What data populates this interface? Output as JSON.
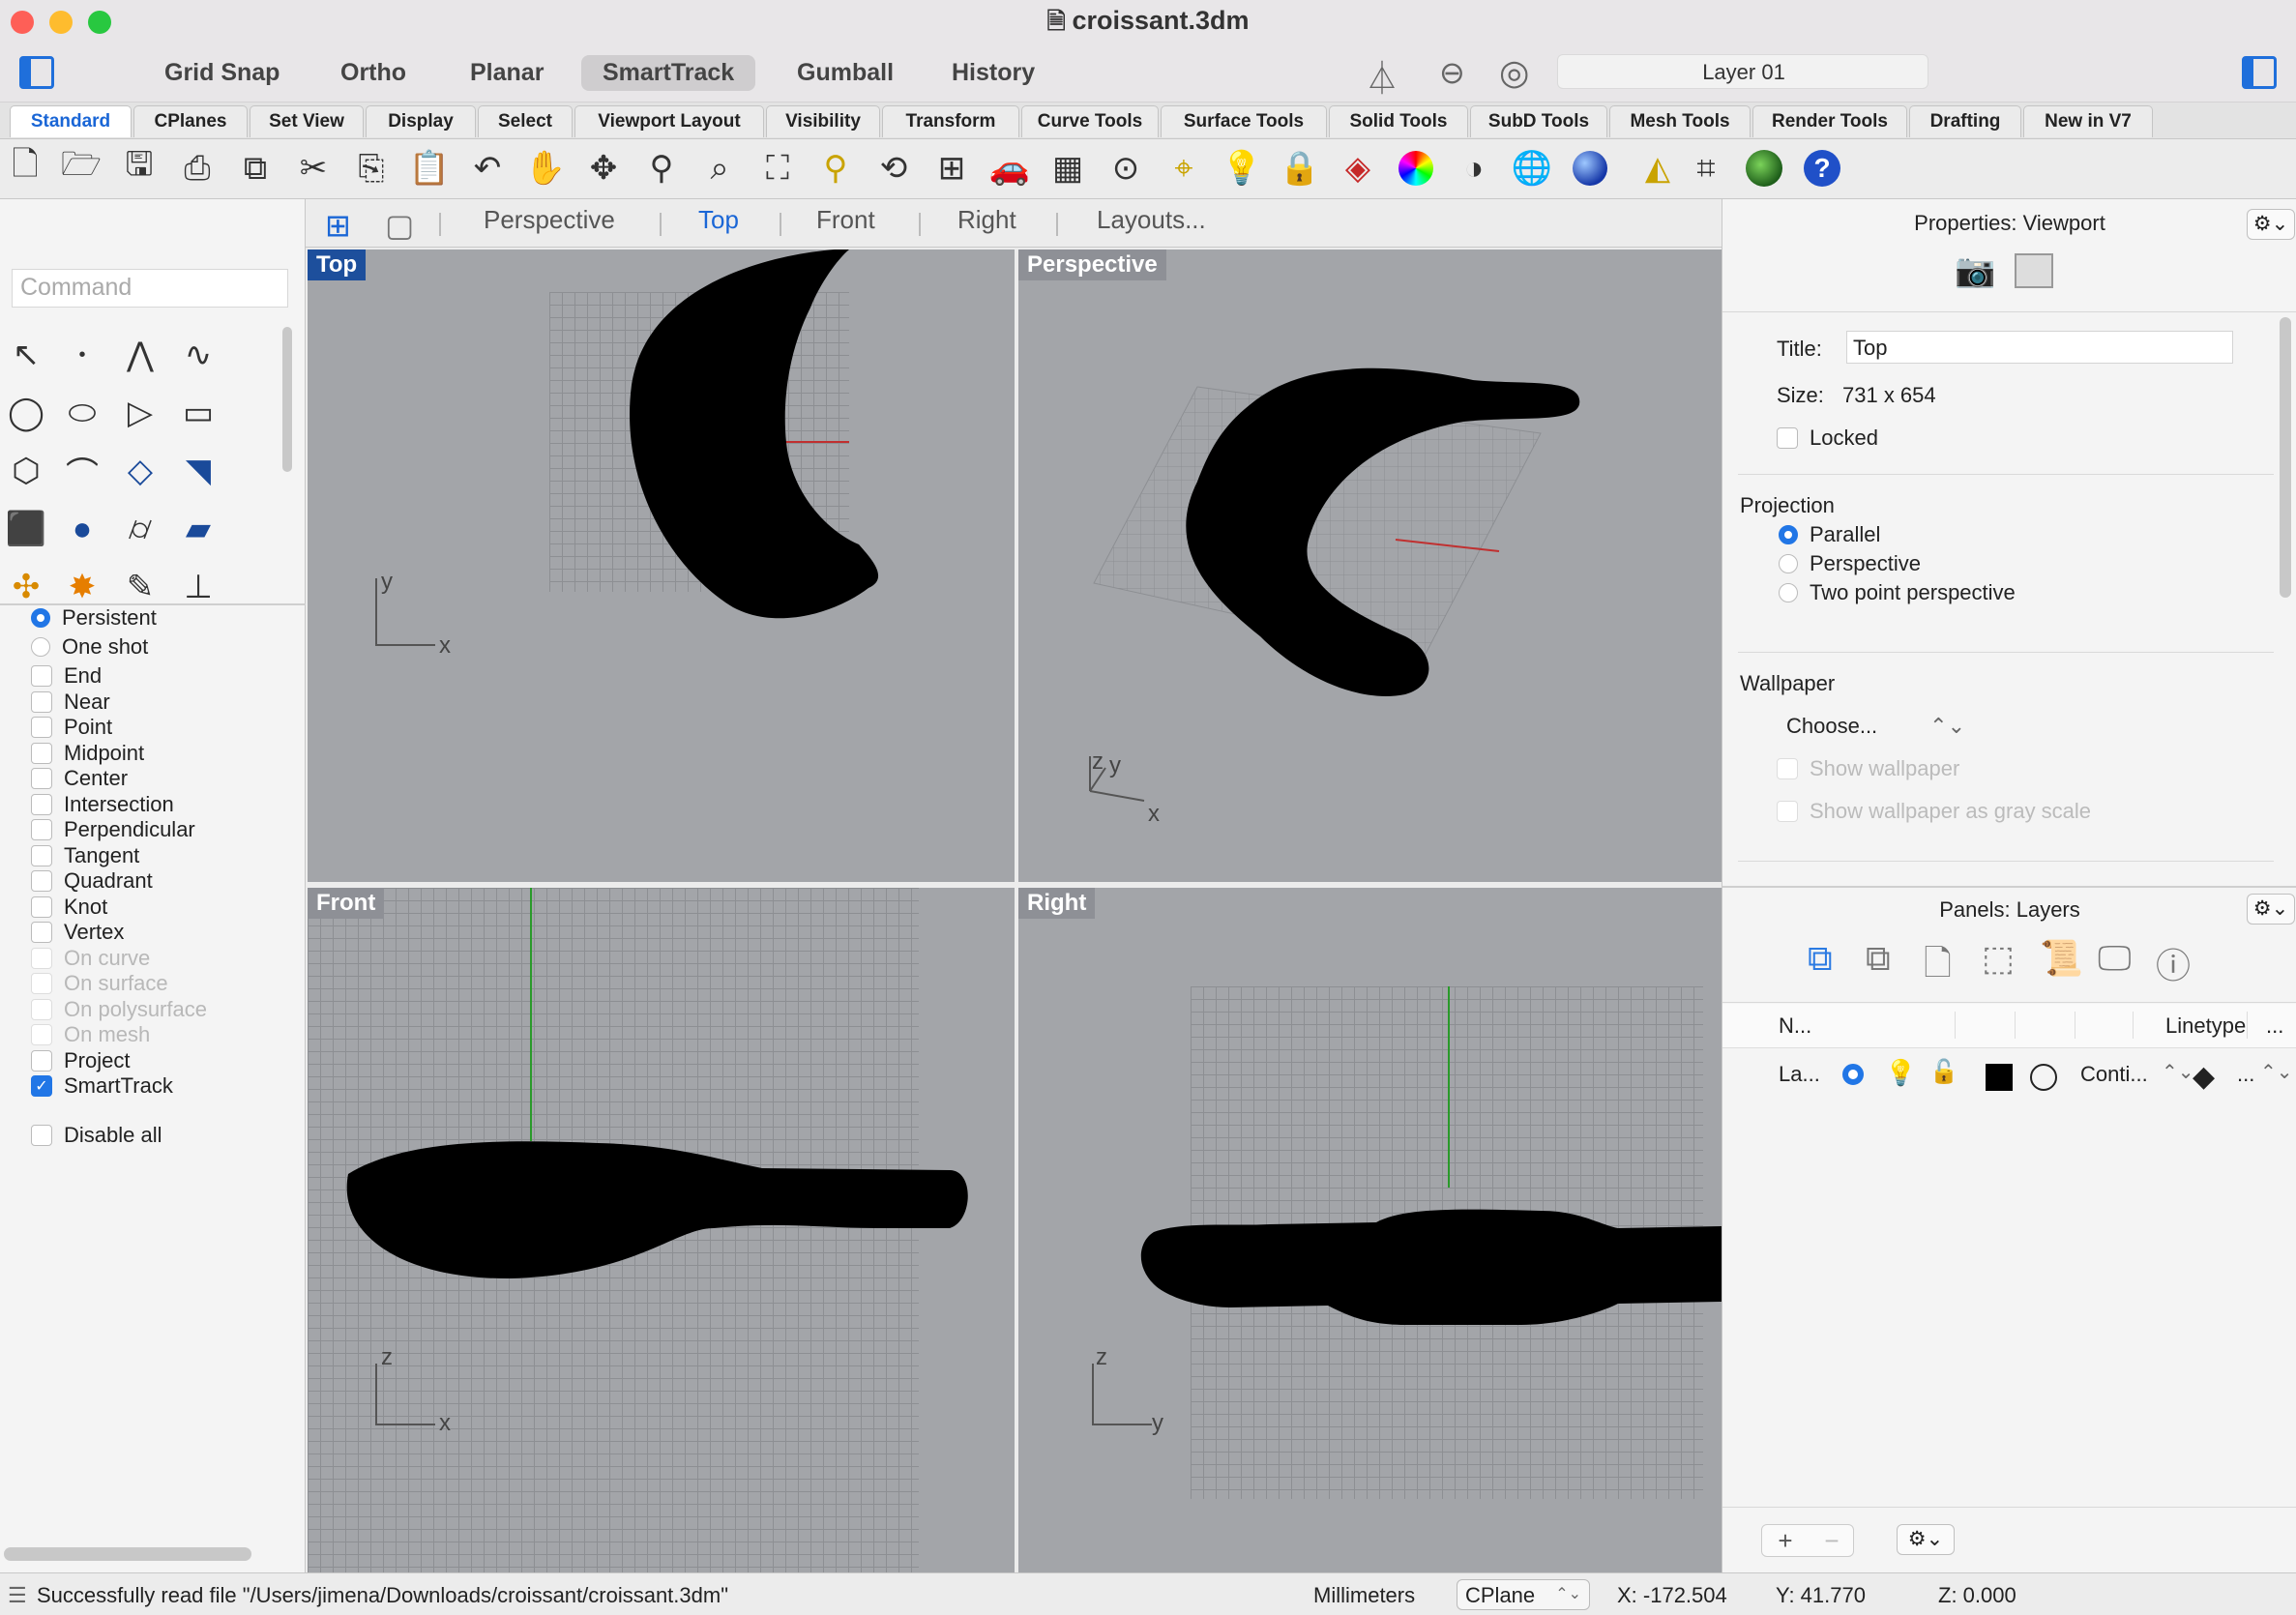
{
  "window": {
    "title": "croissant.3dm"
  },
  "topbar": {
    "toggles": [
      "Grid Snap",
      "Ortho",
      "Planar",
      "SmartTrack",
      "Gumball",
      "History"
    ],
    "active_toggle": "SmartTrack",
    "layer_name": "Layer 01",
    "layer_color": "#000000"
  },
  "tabs": [
    "Standard",
    "CPlanes",
    "Set View",
    "Display",
    "Select",
    "Viewport Layout",
    "Visibility",
    "Transform",
    "Curve Tools",
    "Surface Tools",
    "Solid Tools",
    "SubD Tools",
    "Mesh Tools",
    "Render Tools",
    "Drafting",
    "New in V7"
  ],
  "active_tab": "Standard",
  "toolbar_icons": [
    "new-file-icon",
    "open-file-icon",
    "save-icon",
    "print-icon",
    "import-icon",
    "cut-icon",
    "copy-icon",
    "paste-icon",
    "undo-icon",
    "pan-hand-icon",
    "rotate-view-icon",
    "zoom-icon",
    "zoom-window-icon",
    "zoom-extents-icon",
    "zoom-selected-icon",
    "undo-view-icon",
    "four-viewports-icon",
    "car-icon",
    "grid-toggle-icon",
    "point-snap-icon",
    "osnap-icon",
    "light-bulb-icon",
    "lock-icon",
    "layers-icon",
    "color-wheel-icon",
    "sphere-shaded-icon",
    "sphere-wire-icon",
    "blue-sphere-icon",
    "pointer-cone-icon",
    "dimension-icon",
    "render-globe-icon",
    "help-icon"
  ],
  "command": {
    "placeholder": "Command"
  },
  "viewport_tabs": [
    "Perspective",
    "Top",
    "Front",
    "Right",
    "Layouts..."
  ],
  "active_viewport_tab": "Top",
  "viewports": {
    "top": {
      "label": "Top",
      "axis1": "y",
      "axis2": "x"
    },
    "perspective": {
      "label": "Perspective",
      "axis1": "z",
      "axis1b": "y",
      "axis2": "x"
    },
    "front": {
      "label": "Front",
      "axis1": "z",
      "axis2": "x"
    },
    "right": {
      "label": "Right",
      "axis1": "z",
      "axis2": "y"
    }
  },
  "osnap": {
    "modes": [
      {
        "label": "Persistent",
        "checked": true
      },
      {
        "label": "One shot",
        "checked": false
      }
    ],
    "items": [
      {
        "label": "End",
        "checked": false,
        "disabled": false
      },
      {
        "label": "Near",
        "checked": false,
        "disabled": false
      },
      {
        "label": "Point",
        "checked": false,
        "disabled": false
      },
      {
        "label": "Midpoint",
        "checked": false,
        "disabled": false
      },
      {
        "label": "Center",
        "checked": false,
        "disabled": false
      },
      {
        "label": "Intersection",
        "checked": false,
        "disabled": false
      },
      {
        "label": "Perpendicular",
        "checked": false,
        "disabled": false
      },
      {
        "label": "Tangent",
        "checked": false,
        "disabled": false
      },
      {
        "label": "Quadrant",
        "checked": false,
        "disabled": false
      },
      {
        "label": "Knot",
        "checked": false,
        "disabled": false
      },
      {
        "label": "Vertex",
        "checked": false,
        "disabled": false
      },
      {
        "label": "On curve",
        "checked": false,
        "disabled": true
      },
      {
        "label": "On surface",
        "checked": false,
        "disabled": true
      },
      {
        "label": "On polysurface",
        "checked": false,
        "disabled": true
      },
      {
        "label": "On mesh",
        "checked": false,
        "disabled": true
      },
      {
        "label": "Project",
        "checked": false,
        "disabled": false
      },
      {
        "label": "SmartTrack",
        "checked": true,
        "disabled": false
      }
    ],
    "disable_all": "Disable all"
  },
  "properties": {
    "title": "Properties: Viewport",
    "title_label": "Title:",
    "title_value": "Top",
    "size_label": "Size:",
    "size_value": "731 x 654",
    "locked_label": "Locked",
    "projection_label": "Projection",
    "projection_options": [
      {
        "label": "Parallel",
        "checked": true
      },
      {
        "label": "Perspective",
        "checked": false
      },
      {
        "label": "Two point perspective",
        "checked": false
      }
    ],
    "wallpaper_label": "Wallpaper",
    "wallpaper_choose": "Choose...",
    "show_wallpaper": "Show wallpaper",
    "show_wallpaper_gray": "Show wallpaper as gray scale"
  },
  "layers_panel": {
    "title": "Panels: Layers",
    "columns": [
      "N...",
      "Linetype",
      "..."
    ],
    "row": {
      "name": "La...",
      "linetype": "Conti...",
      "extra": "..."
    }
  },
  "status": {
    "message": "Successfully read file \"/Users/jimena/Downloads/croissant/croissant.3dm\"",
    "units": "Millimeters",
    "cplane": "CPlane",
    "x": "X: -172.504",
    "y": "Y: 41.770",
    "z": "Z: 0.000"
  }
}
